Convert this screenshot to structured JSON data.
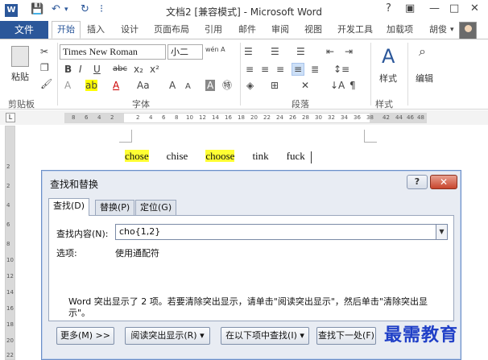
{
  "window": {
    "title": "文档2 [兼容模式] - Microsoft Word",
    "help": "?",
    "minimize": "—",
    "restore": "□",
    "close": "✕",
    "ribbon_opt": "▣"
  },
  "qat": {
    "save": "💾",
    "undo": "↶",
    "undo_dd": "▾",
    "redo": "↻",
    "more": "⁝"
  },
  "ribbon": {
    "file_tab": "文件",
    "tabs": [
      "开始",
      "插入",
      "设计",
      "页面布局",
      "引用",
      "邮件",
      "审阅",
      "视图",
      "开发工具",
      "加载项"
    ],
    "user_name": "胡俊",
    "user_dd": "▾",
    "font_name": "Times New Roman",
    "font_size": "小二",
    "groups": {
      "clipboard": "剪贴板",
      "font": "字体",
      "paragraph": "段落",
      "styles": "样式",
      "editing": "编辑"
    },
    "paste_label": "粘贴",
    "styles_label": "样式",
    "edit_label": "编辑",
    "font_buttons": [
      "B",
      "I",
      "U",
      "abc",
      "x₂",
      "x²",
      "A",
      "Aa",
      "A",
      "A"
    ],
    "wen_icon": "wén A"
  },
  "ruler": {
    "numbers": [
      "8",
      "6",
      "4",
      "2",
      "2",
      "4",
      "6",
      "8",
      "10",
      "12",
      "14",
      "16",
      "18",
      "20",
      "22",
      "24",
      "26",
      "28",
      "30",
      "32",
      "34",
      "36",
      "38",
      "42",
      "44",
      "46",
      "48"
    ],
    "vnumbers": [
      "2",
      "2",
      "4",
      "6",
      "8",
      "10",
      "12",
      "14",
      "16",
      "18",
      "20",
      "22"
    ],
    "tab_icon": "L"
  },
  "document": {
    "words": [
      {
        "text": "chose",
        "highlight": true
      },
      {
        "text": "chise",
        "highlight": false
      },
      {
        "text": "choose",
        "highlight": true
      },
      {
        "text": "tink",
        "highlight": false
      },
      {
        "text": "fuck",
        "highlight": false
      }
    ]
  },
  "dialog": {
    "title": "查找和替换",
    "help": "?",
    "close": "✕",
    "tabs": [
      "查找(D)",
      "替换(P)",
      "定位(G)"
    ],
    "find_label": "查找内容(N):",
    "find_value": "cho{1,2}",
    "dropdown": "▼",
    "options_label": "选项:",
    "options_value": "使用通配符",
    "message": "Word 突出显示了 2 项。若要清除突出显示，请单击\"阅读突出显示\"，然后单击\"清除突出显示\"。",
    "buttons": {
      "more": "更多(M) >>",
      "reading_highlight": "阅读突出显示(R) ▾",
      "find_in": "在以下项中查找(I) ▾",
      "find_next": "查找下一处(F)"
    }
  },
  "watermark": "最需教育"
}
